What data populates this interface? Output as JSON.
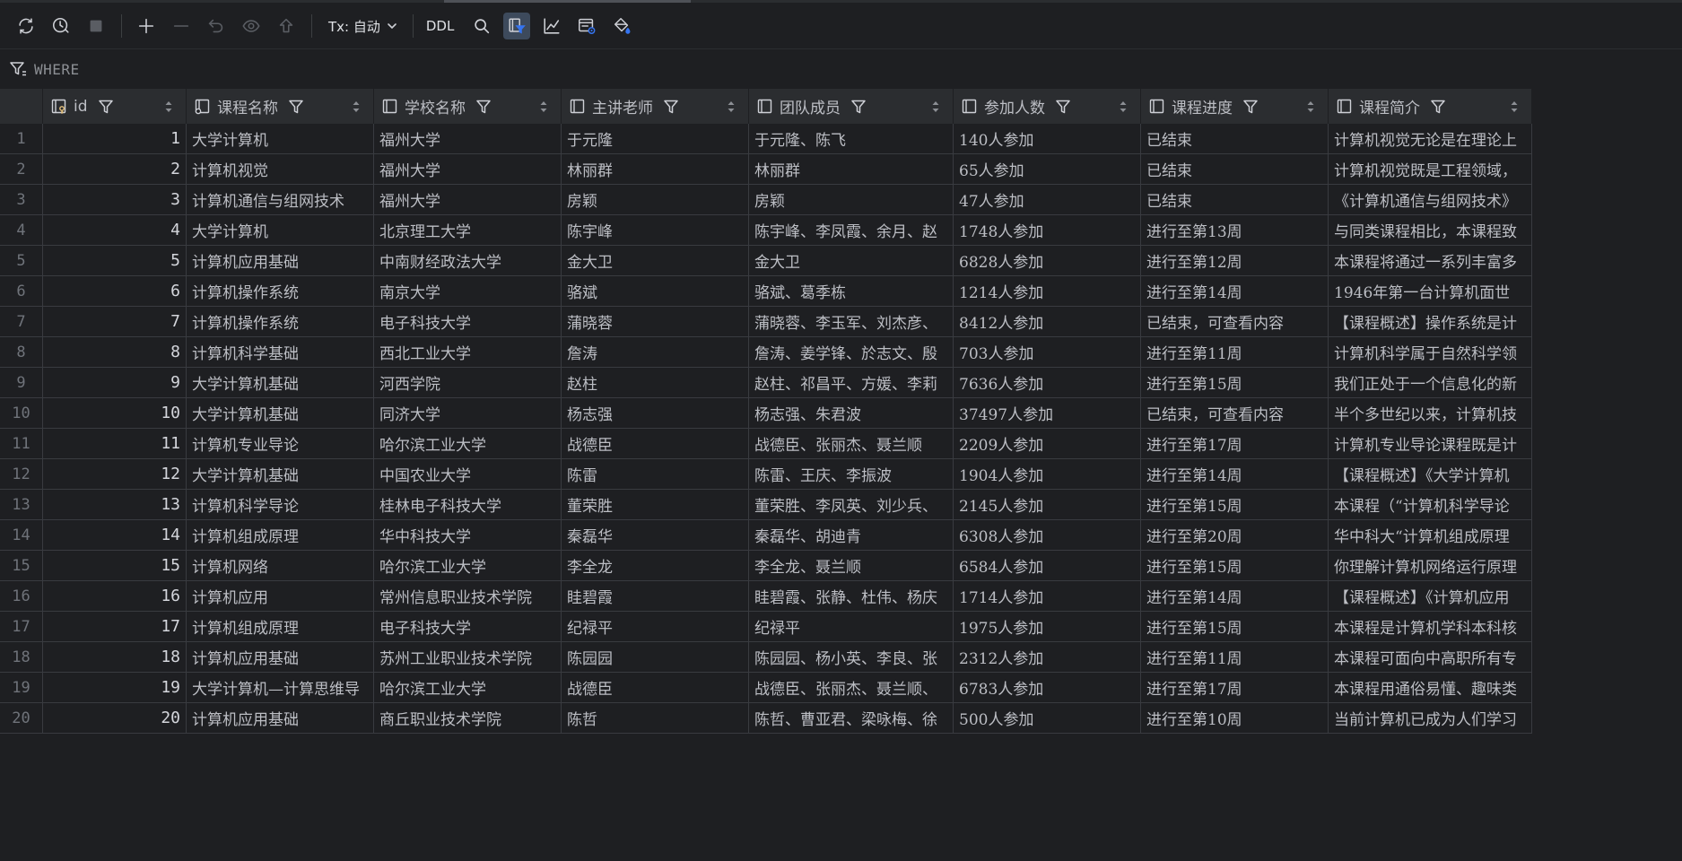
{
  "toolbar": {
    "tx_label": "Tx: 自动",
    "ddl_label": "DDL"
  },
  "filter": {
    "where_label": "WHERE"
  },
  "columns": [
    "id",
    "课程名称",
    "学校名称",
    "主讲老师",
    "团队成员",
    "参加人数",
    "课程进度",
    "课程简介"
  ],
  "rows": [
    [
      "1",
      "大学计算机",
      "福州大学",
      "于元隆",
      "于元隆、陈飞",
      "140人参加",
      "已结束",
      "计算机视觉无论是在理论上"
    ],
    [
      "2",
      "计算机视觉",
      "福州大学",
      "林丽群",
      "林丽群",
      "65人参加",
      "已结束",
      "计算机视觉既是工程领域，"
    ],
    [
      "3",
      "计算机通信与组网技术",
      "福州大学",
      "房颖",
      "房颖",
      "47人参加",
      "已结束",
      "《计算机通信与组网技术》"
    ],
    [
      "4",
      "大学计算机",
      "北京理工大学",
      "陈宇峰",
      "陈宇峰、李凤霞、余月、赵",
      "1748人参加",
      "进行至第13周",
      "与同类课程相比，本课程致"
    ],
    [
      "5",
      "计算机应用基础",
      "中南财经政法大学",
      "金大卫",
      "金大卫",
      "6828人参加",
      "进行至第12周",
      "本课程将通过一系列丰富多"
    ],
    [
      "6",
      "计算机操作系统",
      "南京大学",
      "骆斌",
      "骆斌、葛季栋",
      "1214人参加",
      "进行至第14周",
      "1946年第一台计算机面世"
    ],
    [
      "7",
      "计算机操作系统",
      "电子科技大学",
      "蒲晓蓉",
      "蒲晓蓉、李玉军、刘杰彦、",
      "8412人参加",
      "已结束，可查看内容",
      "【课程概述】操作系统是计"
    ],
    [
      "8",
      "计算机科学基础",
      "西北工业大学",
      "詹涛",
      "詹涛、姜学锋、於志文、殷",
      "703人参加",
      "进行至第11周",
      "计算机科学属于自然科学领"
    ],
    [
      "9",
      "大学计算机基础",
      "河西学院",
      "赵柱",
      "赵柱、祁昌平、方媛、李莉",
      "7636人参加",
      "进行至第15周",
      "我们正处于一个信息化的新"
    ],
    [
      "10",
      "大学计算机基础",
      "同济大学",
      "杨志强",
      "杨志强、朱君波",
      "37497人参加",
      "已结束，可查看内容",
      "半个多世纪以来，计算机技"
    ],
    [
      "11",
      "计算机专业导论",
      "哈尔滨工业大学",
      "战德臣",
      "战德臣、张丽杰、聂兰顺",
      "2209人参加",
      "进行至第17周",
      "计算机专业导论课程既是计"
    ],
    [
      "12",
      "大学计算机基础",
      "中国农业大学",
      "陈雷",
      "陈雷、王庆、李振波",
      "1904人参加",
      "进行至第14周",
      "【课程概述】《大学计算机"
    ],
    [
      "13",
      "计算机科学导论",
      "桂林电子科技大学",
      "董荣胜",
      "董荣胜、李凤英、刘少兵、",
      "2145人参加",
      "进行至第15周",
      "本课程（“计算机科学导论"
    ],
    [
      "14",
      "计算机组成原理",
      "华中科技大学",
      "秦磊华",
      "秦磊华、胡迪青",
      "6308人参加",
      "进行至第20周",
      "华中科大“计算机组成原理"
    ],
    [
      "15",
      "计算机网络",
      "哈尔滨工业大学",
      "李全龙",
      "李全龙、聂兰顺",
      "6584人参加",
      "进行至第15周",
      "你理解计算机网络运行原理"
    ],
    [
      "16",
      "计算机应用",
      "常州信息职业技术学院",
      "眭碧霞",
      "眭碧霞、张静、杜伟、杨庆",
      "1714人参加",
      "进行至第14周",
      "【课程概述】《计算机应用"
    ],
    [
      "17",
      "计算机组成原理",
      "电子科技大学",
      "纪禄平",
      "纪禄平",
      "1975人参加",
      "进行至第15周",
      "本课程是计算机学科本科核"
    ],
    [
      "18",
      "计算机应用基础",
      "苏州工业职业技术学院",
      "陈园园",
      "陈园园、杨小英、李良、张",
      "2312人参加",
      "进行至第11周",
      "本课程可面向中高职所有专"
    ],
    [
      "19",
      "大学计算机—计算思维导",
      "哈尔滨工业大学",
      "战德臣",
      "战德臣、张丽杰、聂兰顺、",
      "6783人参加",
      "进行至第17周",
      "本课程用通俗易懂、趣味类"
    ],
    [
      "20",
      "计算机应用基础",
      "商丘职业技术学院",
      "陈哲",
      "陈哲、曹亚君、梁咏梅、徐",
      "500人参加",
      "进行至第10周",
      "当前计算机已成为人们学习"
    ]
  ]
}
